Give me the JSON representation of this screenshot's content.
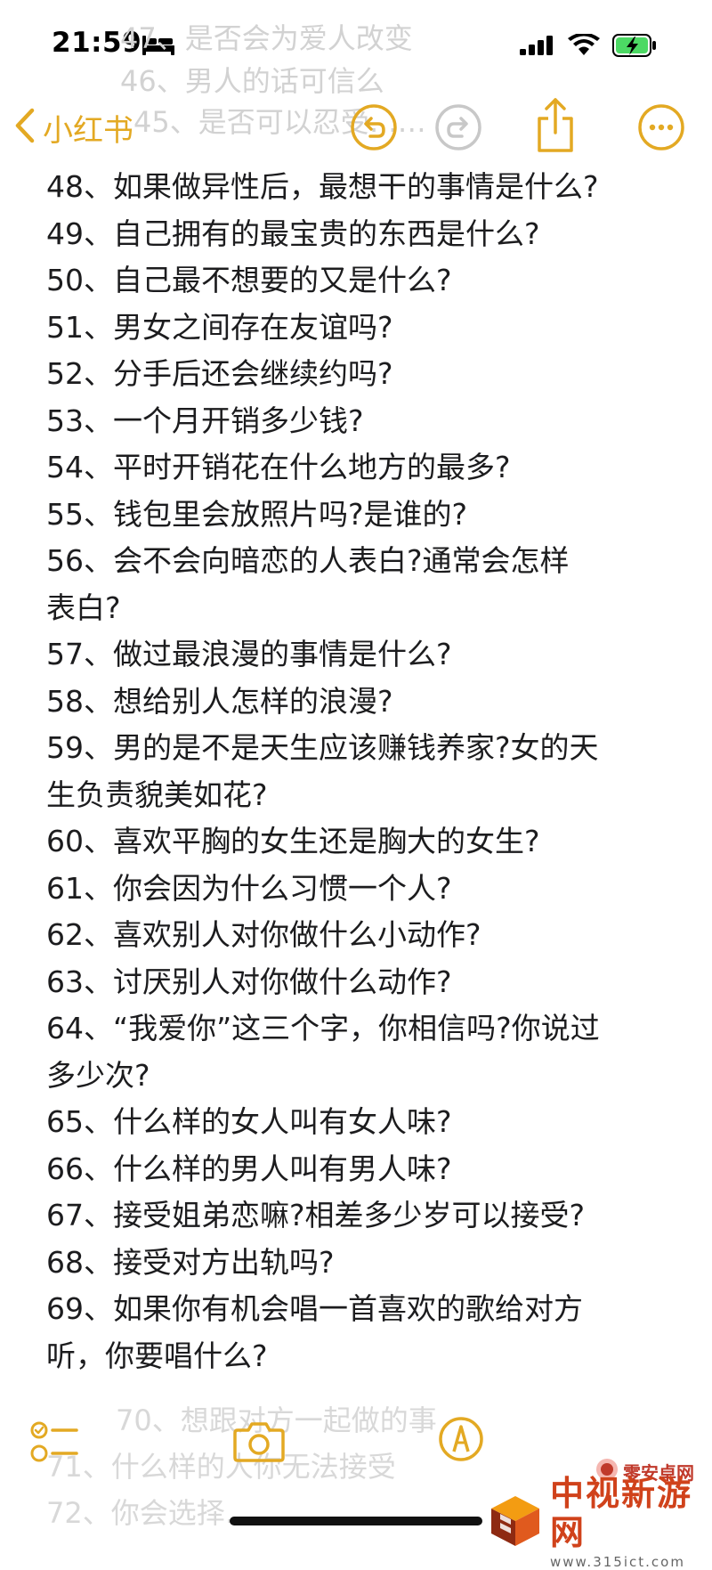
{
  "status_bar": {
    "time": "21:59"
  },
  "background_ghost": {
    "top_lines": [
      "47、是否会为爱人改变",
      "46、男人的话可信么",
      "45、是否可以忍受……"
    ],
    "bottom_lines": [
      "70、想跟对方一起做的事",
      "71、什么样的人你无法接受",
      "72、你会选择……"
    ]
  },
  "nav": {
    "back_label": "小红书"
  },
  "note": {
    "lines": [
      "48、如果做异性后，最想干的事情是什么?",
      "49、自己拥有的最宝贵的东西是什么?",
      "50、自己最不想要的又是什么?",
      "51、男女之间存在友谊吗?",
      "52、分手后还会继续约吗?",
      "53、一个月开销多少钱?",
      "54、平时开销花在什么地方的最多?",
      "55、钱包里会放照片吗?是谁的?",
      "56、会不会向暗恋的人表白?通常会怎样",
      "表白?",
      "57、做过最浪漫的事情是什么?",
      "58、想给别人怎样的浪漫?",
      "59、男的是不是天生应该赚钱养家?女的天",
      "生负责貌美如花?",
      "60、喜欢平胸的女生还是胸大的女生?",
      "61、你会因为什么习惯一个人?",
      "62、喜欢别人对你做什么小动作?",
      "63、讨厌别人对你做什么动作?",
      "64、“我爱你”这三个字，你相信吗?你说过",
      "多少次?",
      "65、什么样的女人叫有女人味?",
      "66、什么样的男人叫有男人味?",
      "67、接受姐弟恋嘛?相差多少岁可以接受?",
      "68、接受对方出轨吗?",
      "69、如果你有机会唱一首喜欢的歌给对方",
      "听，你要唱什么?"
    ]
  },
  "watermark": {
    "small": "零安卓网",
    "title": "中视新游网",
    "url": "www.315ict.com"
  },
  "colors": {
    "accent": "#e3a923",
    "text": "#1c1c1e",
    "watermark": "#d0421b"
  },
  "icons": [
    "bed-icon",
    "signal-icon",
    "wifi-icon",
    "battery-icon",
    "chevron-left-icon",
    "undo-icon",
    "redo-icon",
    "share-icon",
    "more-icon",
    "checklist-icon",
    "camera-icon",
    "markup-icon"
  ]
}
